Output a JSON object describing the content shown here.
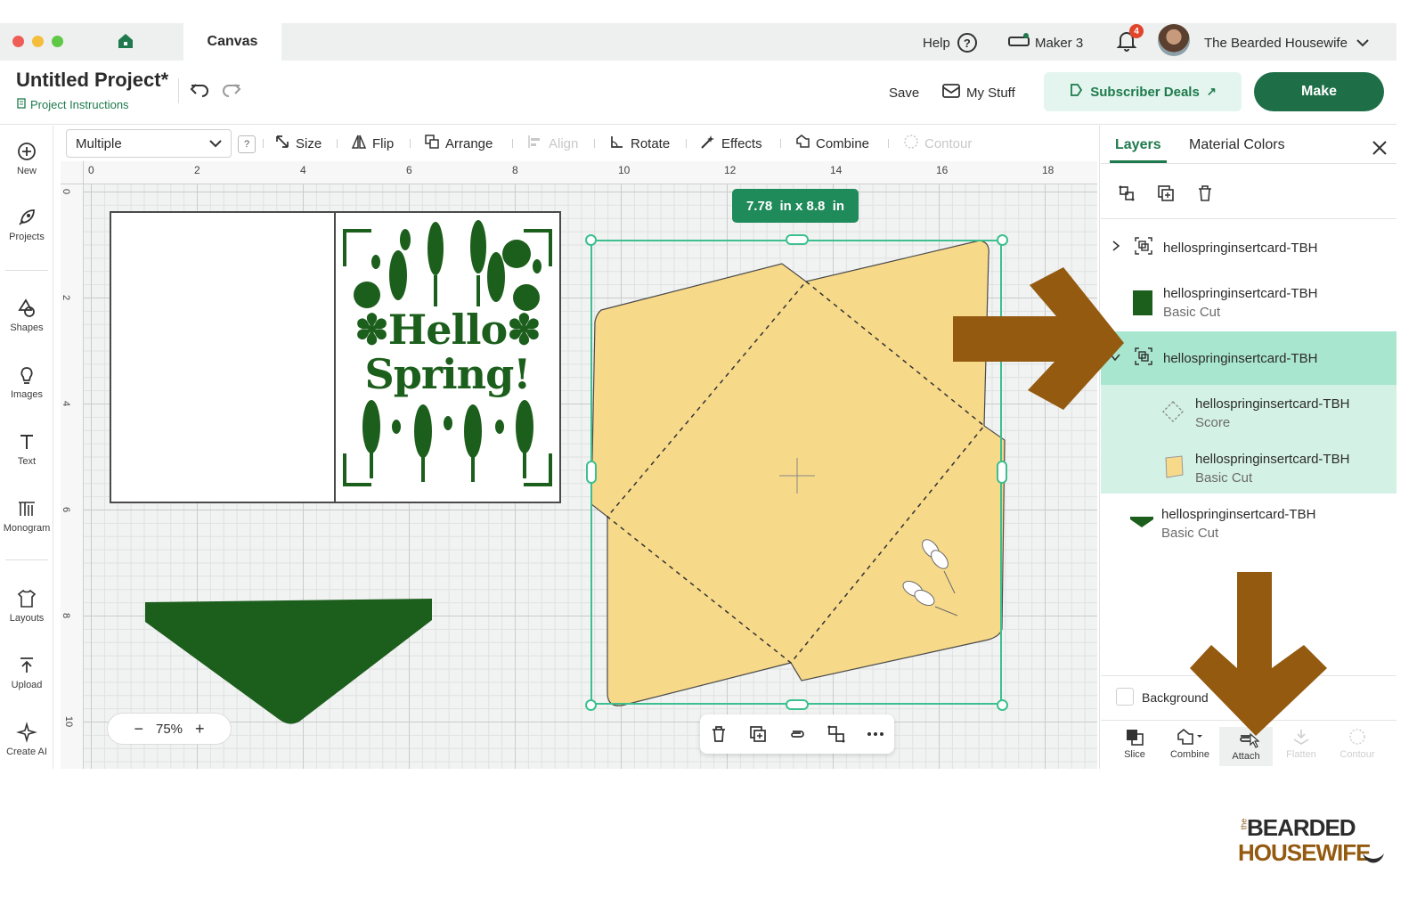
{
  "app": {
    "tab_label": "Canvas",
    "help_label": "Help",
    "machine_label": "Maker 3",
    "notification_count": "4",
    "user_name": "The Bearded Housewife"
  },
  "header": {
    "project_title": "Untitled Project*",
    "project_instructions": "Project Instructions",
    "save_label": "Save",
    "my_stuff_label": "My Stuff",
    "subscriber_label": "Subscriber Deals",
    "make_label": "Make"
  },
  "sidebar": {
    "items": [
      {
        "label": "New",
        "icon": "plus-circle-icon"
      },
      {
        "label": "Projects",
        "icon": "rocket-icon"
      },
      {
        "label": "Shapes",
        "icon": "shapes-icon"
      },
      {
        "label": "Images",
        "icon": "lightbulb-icon"
      },
      {
        "label": "Text",
        "icon": "text-icon"
      },
      {
        "label": "Monogram",
        "icon": "monogram-icon"
      },
      {
        "label": "Layouts",
        "icon": "shirt-icon"
      },
      {
        "label": "Upload",
        "icon": "upload-icon"
      },
      {
        "label": "Create AI",
        "icon": "sparkle-icon"
      }
    ]
  },
  "toolbar": {
    "selection_value": "Multiple",
    "help_glyph": "?",
    "size_label": "Size",
    "flip_label": "Flip",
    "arrange_label": "Arrange",
    "align_label": "Align",
    "rotate_label": "Rotate",
    "effects_label": "Effects",
    "combine_label": "Combine",
    "contour_label": "Contour"
  },
  "ruler": {
    "top": [
      "0",
      "2",
      "4",
      "6",
      "8",
      "10",
      "12",
      "14",
      "16",
      "18"
    ],
    "left": [
      "0",
      "2",
      "4",
      "6",
      "8",
      "10"
    ]
  },
  "canvas": {
    "selection_dimensions": "7.78  in x 8.8  in",
    "card_text_line1": "✽Hello✽",
    "card_text_line2": "Spring!",
    "zoom_level": "75%",
    "zoom_minus": "−",
    "zoom_plus": "+",
    "colors": {
      "dark_green": "#1c5e1c",
      "envelope_yellow": "#f7d98a",
      "selection_teal": "#3dbf8f",
      "arrow_brown": "#935a10"
    }
  },
  "right_panel": {
    "tabs": [
      "Layers",
      "Material Colors"
    ],
    "layers": [
      {
        "name": "hellospringinsertcard-TBH",
        "sub": "",
        "type": "group"
      },
      {
        "name": "hellospringinsertcard-TBH",
        "sub": "Basic Cut",
        "type": "green-rect"
      },
      {
        "name": "hellospringinsertcard-TBH",
        "sub": "",
        "type": "group-selected"
      },
      {
        "name": "hellospringinsertcard-TBH",
        "sub": "Score",
        "type": "score"
      },
      {
        "name": "hellospringinsertcard-TBH",
        "sub": "Basic Cut",
        "type": "yellow"
      },
      {
        "name": "hellospringinsertcard-TBH",
        "sub": "Basic Cut",
        "type": "green-triangle"
      }
    ],
    "background_label": "Background",
    "bottom_tools": [
      "Slice",
      "Combine",
      "Attach",
      "Flatten",
      "Contour"
    ]
  },
  "watermark": {
    "prefix": "the",
    "line1": "BEARDED",
    "line2": "HOUSEWIFE"
  }
}
